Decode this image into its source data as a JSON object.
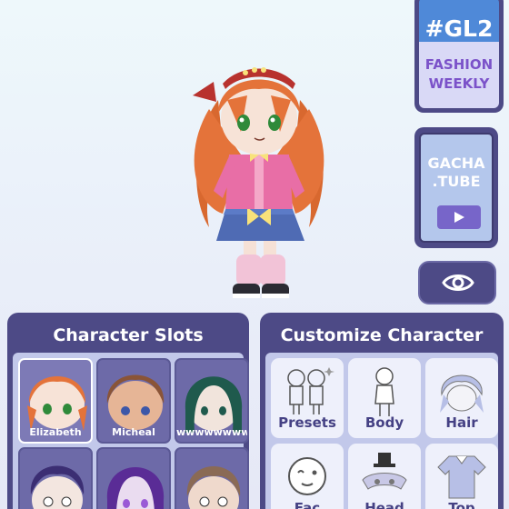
{
  "promo": {
    "gl2_tag": "#GL2",
    "gl2_line1": "FASHION",
    "gl2_line2": "WEEKLY",
    "tube_line1": "GACHA",
    "tube_line2": ".TUBE"
  },
  "character_slots": {
    "title": "Character Slots",
    "slots": [
      {
        "name": "Elizabeth",
        "hair": "#e4733a",
        "selected": true
      },
      {
        "name": "Micheal",
        "hair": "#8a5437",
        "selected": false
      },
      {
        "name": "wwwwwwww",
        "hair": "#1f5a4d",
        "selected": false
      },
      {
        "name": "",
        "hair": "#3b2e73",
        "selected": false
      },
      {
        "name": "",
        "hair": "#5a2c96",
        "selected": false
      },
      {
        "name": "",
        "hair": "#8a6a55",
        "selected": false
      }
    ]
  },
  "customize": {
    "title": "Customize Character",
    "items": [
      {
        "label": "Presets",
        "icon": "presets-icon"
      },
      {
        "label": "Body",
        "icon": "body-icon"
      },
      {
        "label": "Hair",
        "icon": "hair-icon"
      },
      {
        "label": "Fac",
        "icon": "face-icon"
      },
      {
        "label": "Head",
        "icon": "head-accessory-icon"
      },
      {
        "label": "Top",
        "icon": "top-icon"
      }
    ]
  },
  "colors": {
    "panel": "#4d4a86",
    "panel_body": "#c2c8ea",
    "accent": "#7b52c9",
    "gl2_blue": "#4f89d8"
  }
}
